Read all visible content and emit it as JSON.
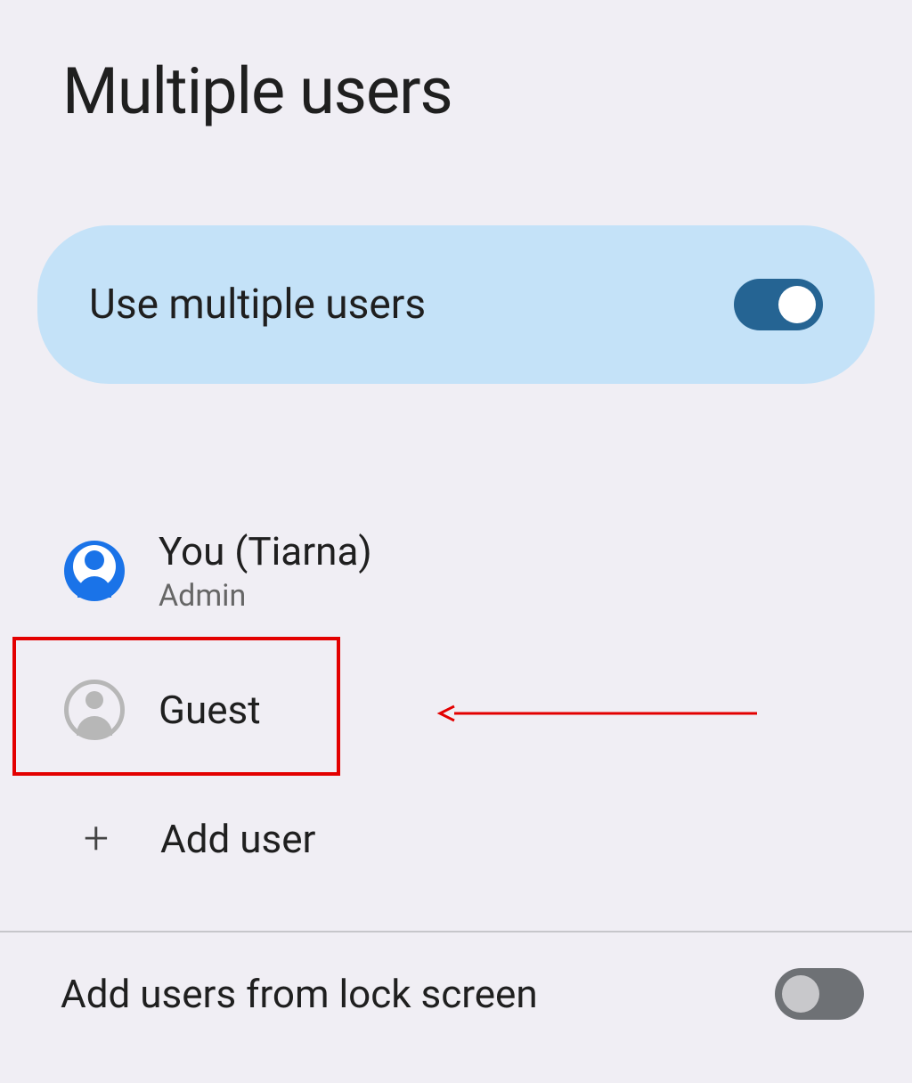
{
  "header": {
    "title": "Multiple users"
  },
  "toggleCard": {
    "label": "Use multiple users",
    "enabled": true
  },
  "users": {
    "primary": {
      "name": "You (Tiarna)",
      "role": "Admin"
    },
    "guest": {
      "name": "Guest"
    }
  },
  "addUser": {
    "label": "Add user"
  },
  "lockScreen": {
    "label": "Add users from lock screen",
    "enabled": false
  }
}
